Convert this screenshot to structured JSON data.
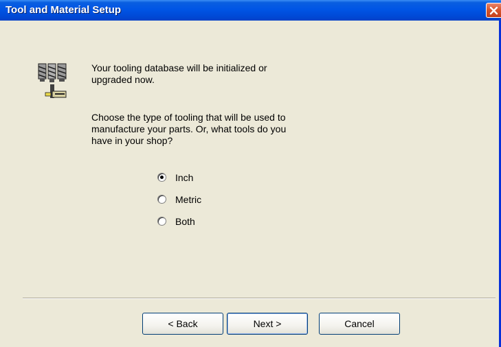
{
  "window": {
    "title": "Tool and Material Setup",
    "close_icon": "close-icon"
  },
  "content": {
    "icon": "tooling-icon",
    "intro_lines": [
      "Your tooling database will be initialized or",
      "upgraded now."
    ],
    "prompt_lines": [
      "Choose the type of tooling that will be used to",
      "manufacture your parts.  Or, what tools do you",
      "have in your shop?"
    ],
    "tooling_options": [
      {
        "label": "Inch",
        "selected": true
      },
      {
        "label": "Metric",
        "selected": false
      },
      {
        "label": "Both",
        "selected": false
      }
    ]
  },
  "buttons": {
    "back_label": "< Back",
    "next_label": "Next >",
    "cancel_label": "Cancel"
  },
  "colors": {
    "titlebar": "#0055e5",
    "dialog_background": "#ece9d8",
    "close_button": "#d9572e"
  }
}
